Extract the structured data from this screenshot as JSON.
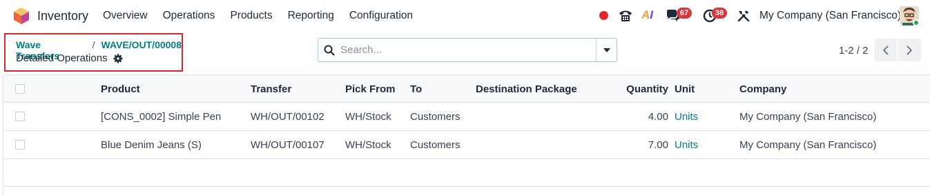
{
  "app": {
    "name": "Inventory"
  },
  "menu": [
    "Overview",
    "Operations",
    "Products",
    "Reporting",
    "Configuration"
  ],
  "systray": {
    "messages_count": "67",
    "activities_count": "38",
    "ai_label": "AI",
    "company": "My Company (San Francisco)"
  },
  "breadcrumb": {
    "parent": "Wave Transfers",
    "current": "WAVE/OUT/00008"
  },
  "page": {
    "title": "Detailed Operations"
  },
  "search": {
    "placeholder": "Search..."
  },
  "pager": {
    "text": "1-2 / 2"
  },
  "table": {
    "columns": {
      "product": "Product",
      "transfer": "Transfer",
      "pick_from": "Pick From",
      "to": "To",
      "dest_package": "Destination Package",
      "quantity": "Quantity",
      "unit": "Unit",
      "company": "Company"
    },
    "rows": [
      {
        "product": "[CONS_0002] Simple Pen",
        "transfer": "WH/OUT/00102",
        "pick_from": "WH/Stock",
        "to": "Customers",
        "dest_package": "",
        "quantity": "4.00",
        "unit": "Units",
        "company": "My Company (San Francisco)"
      },
      {
        "product": "Blue Denim Jeans (S)",
        "transfer": "WH/OUT/00107",
        "pick_from": "WH/Stock",
        "to": "Customers",
        "dest_package": "",
        "quantity": "7.00",
        "unit": "Units",
        "company": "My Company (San Francisco)"
      }
    ]
  },
  "colors": {
    "accent": "#017e84",
    "highlight_border": "#d9252c",
    "badge": "#d9363e",
    "recording": "#e0282e"
  }
}
